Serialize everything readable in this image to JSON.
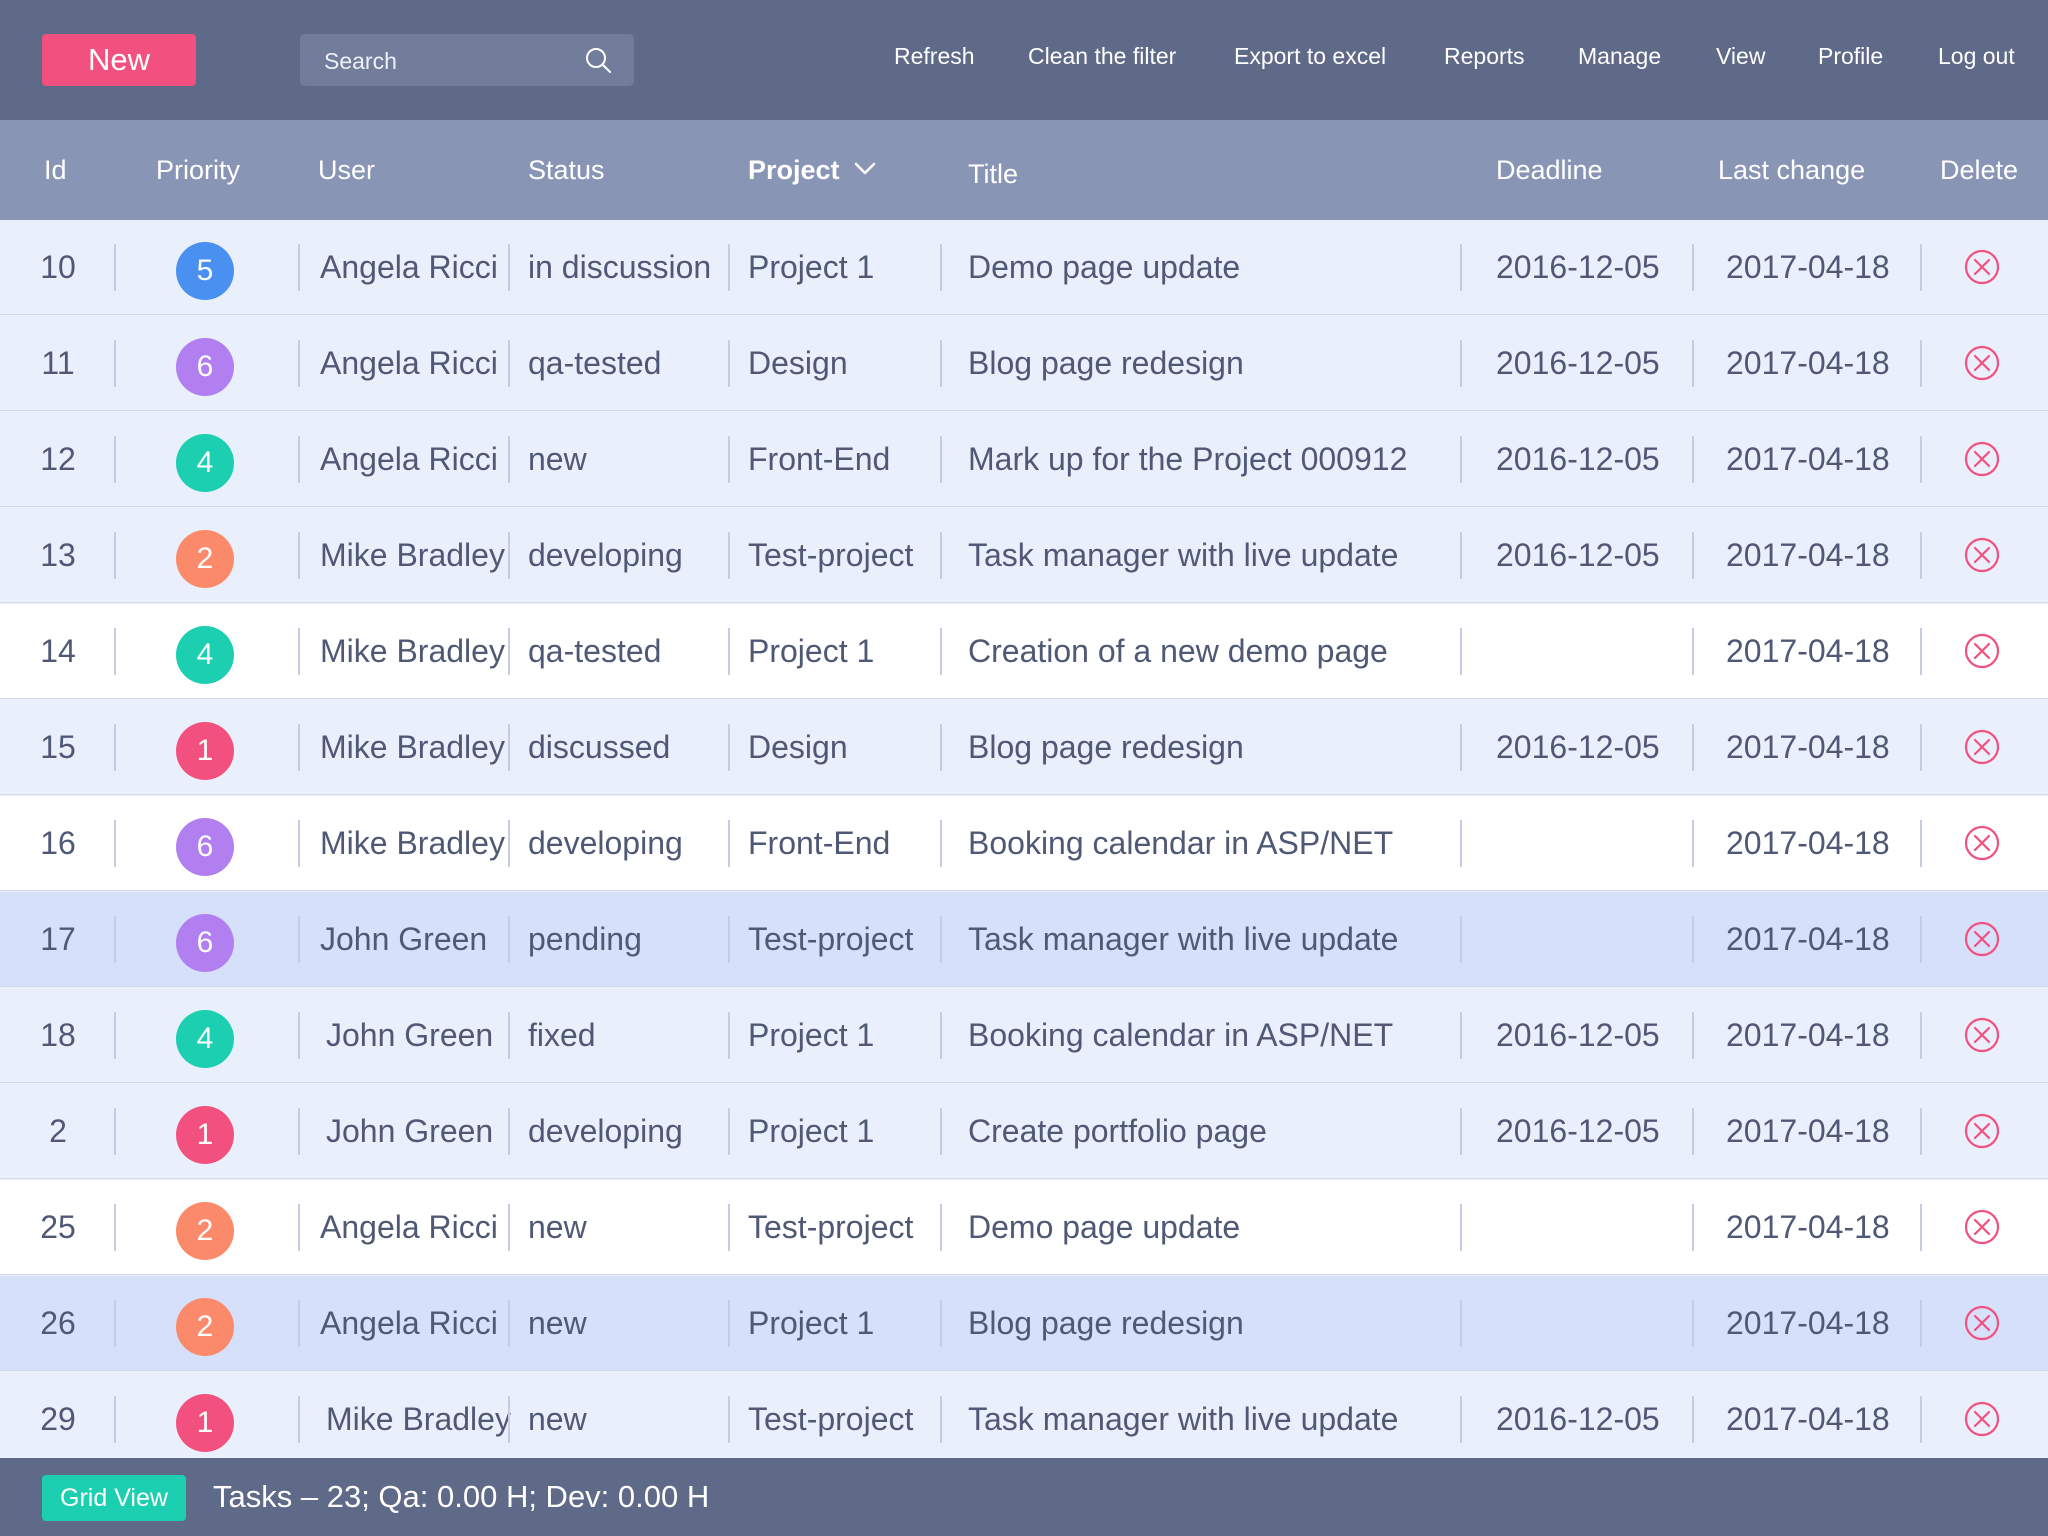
{
  "toolbar": {
    "new_label": "New",
    "search_placeholder": "Search",
    "nav": [
      "Refresh",
      "Clean the filter",
      "Export to excel",
      "Reports",
      "Manage",
      "View",
      "Profile",
      "Log out"
    ]
  },
  "table": {
    "columns": {
      "id": "Id",
      "priority": "Priority",
      "user": "User",
      "status": "Status",
      "project": "Project",
      "title": "Title",
      "deadline": "Deadline",
      "last_change": "Last change",
      "delete": "Delete"
    },
    "rows": [
      {
        "id": "10",
        "priority": "5",
        "user": "Angela Ricci",
        "status": "in discussion",
        "project": "Project 1",
        "title": "Demo page update",
        "deadline": "2016-12-05",
        "last_change": "2017-04-18"
      },
      {
        "id": "11",
        "priority": "6",
        "user": "Angela Ricci",
        "status": "qa-tested",
        "project": "Design",
        "title": "Blog page redesign",
        "deadline": "2016-12-05",
        "last_change": "2017-04-18"
      },
      {
        "id": "12",
        "priority": "4",
        "user": "Angela Ricci",
        "status": "new",
        "project": "Front-End",
        "title": "Mark up for the Project 000912",
        "deadline": "2016-12-05",
        "last_change": "2017-04-18"
      },
      {
        "id": "13",
        "priority": "2",
        "user": "Mike Bradley",
        "status": "developing",
        "project": "Test-project",
        "title": "Task manager with live update",
        "deadline": "2016-12-05",
        "last_change": "2017-04-18"
      },
      {
        "id": "14",
        "priority": "4",
        "user": "Mike Bradley",
        "status": "qa-tested",
        "project": "Project 1",
        "title": "Creation of a new demo page",
        "deadline": "",
        "last_change": "2017-04-18"
      },
      {
        "id": "15",
        "priority": "1",
        "user": "Mike Bradley",
        "status": "discussed",
        "project": "Design",
        "title": "Blog page redesign",
        "deadline": "2016-12-05",
        "last_change": "2017-04-18"
      },
      {
        "id": "16",
        "priority": "6",
        "user": "Mike Bradley",
        "status": "developing",
        "project": "Front-End",
        "title": "Booking calendar in ASP/NET",
        "deadline": "",
        "last_change": "2017-04-18"
      },
      {
        "id": "17",
        "priority": "6",
        "user": "John Green",
        "status": "pending",
        "project": "Test-project",
        "title": "Task manager with live update",
        "deadline": "",
        "last_change": "2017-04-18"
      },
      {
        "id": "18",
        "priority": "4",
        "user": "John Green",
        "status": "fixed",
        "project": "Project 1",
        "title": "Booking calendar in ASP/NET",
        "deadline": "2016-12-05",
        "last_change": "2017-04-18"
      },
      {
        "id": "2",
        "priority": "1",
        "user": "John Green",
        "status": "developing",
        "project": "Project 1",
        "title": "Create portfolio page",
        "deadline": "2016-12-05",
        "last_change": "2017-04-18"
      },
      {
        "id": "25",
        "priority": "2",
        "user": "Angela Ricci",
        "status": "new",
        "project": "Test-project",
        "title": "Demo page update",
        "deadline": "",
        "last_change": "2017-04-18"
      },
      {
        "id": "26",
        "priority": "2",
        "user": "Angela Ricci",
        "status": "new",
        "project": "Project 1",
        "title": "Blog page redesign",
        "deadline": "",
        "last_change": "2017-04-18"
      },
      {
        "id": "29",
        "priority": "1",
        "user": "Mike Bradley",
        "status": "new",
        "project": "Test-project",
        "title": "Task manager with live update",
        "deadline": "2016-12-05",
        "last_change": "2017-04-18"
      }
    ]
  },
  "footer": {
    "view_label": "Grid View",
    "summary": "Tasks – 23; Qa: 0.00 H; Dev: 0.00 H"
  },
  "colors": {
    "topbar": "#5f6a88",
    "header": "#8995b5",
    "accent_new": "#f2517f",
    "accent_grid_view": "#1ccfb0",
    "priority_1": "#f2517f",
    "priority_2": "#fb8a6a",
    "priority_4": "#1ccfb0",
    "priority_5": "#4a90f0",
    "priority_6": "#b27ff0",
    "delete_icon": "#f2517f"
  }
}
